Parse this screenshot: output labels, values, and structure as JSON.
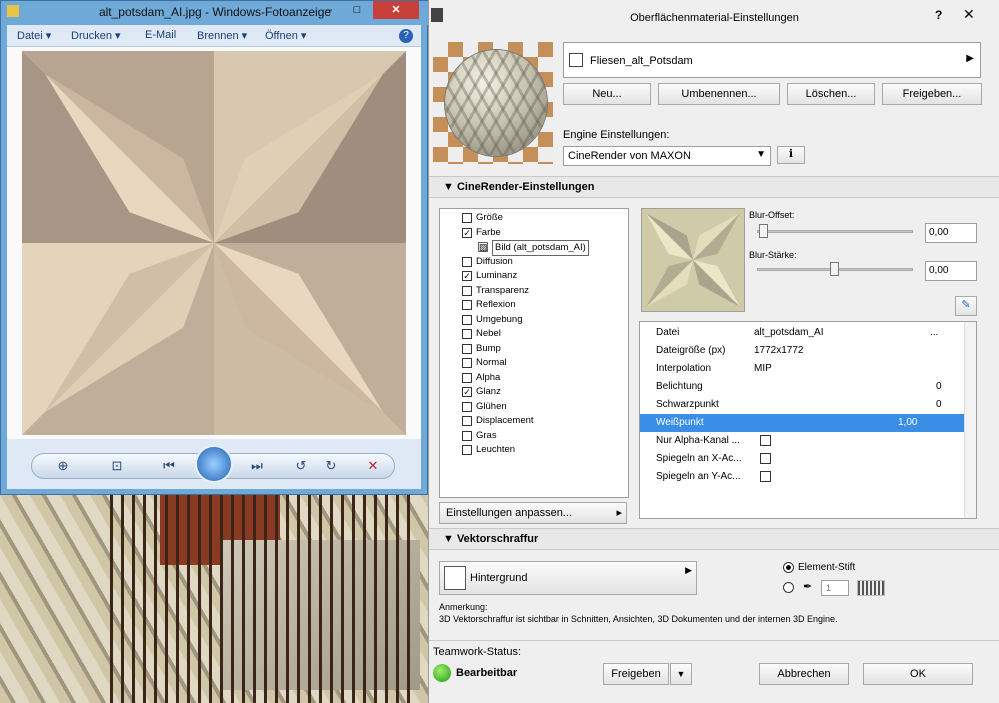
{
  "viewer": {
    "title": "alt_potsdam_AI.jpg - Windows-Fotoanzeige",
    "menu": [
      "Datei ▾",
      "Drucken ▾",
      "E-Mail",
      "Brennen ▾",
      "Öffnen ▾"
    ],
    "toolbar": [
      "zoom-icon",
      "fit-icon",
      "prev-icon",
      "slideshow-icon",
      "next-icon",
      "rotate-left-icon",
      "rotate-right-icon",
      "delete-icon"
    ]
  },
  "dialog": {
    "title": "Oberflächenmaterial-Einstellungen",
    "help": "?",
    "material_name": "Fliesen_alt_Potsdam",
    "buttons": {
      "new": "Neu...",
      "rename": "Umbenennen...",
      "delete": "Löschen...",
      "share": "Freigeben..."
    },
    "engine_label": "Engine Einstellungen:",
    "engine_value": "CineRender von MAXON",
    "section_cine": "CineRender-Einstellungen",
    "tree": [
      {
        "label": "Größe",
        "checked": false
      },
      {
        "label": "Farbe",
        "checked": true
      },
      {
        "label": "Bild (alt_potsdam_AI)",
        "checked": false,
        "child": true
      },
      {
        "label": "Diffusion",
        "checked": false
      },
      {
        "label": "Luminanz",
        "checked": true
      },
      {
        "label": "Transparenz",
        "checked": false
      },
      {
        "label": "Reflexion",
        "checked": false
      },
      {
        "label": "Umgebung",
        "checked": false
      },
      {
        "label": "Nebel",
        "checked": false
      },
      {
        "label": "Bump",
        "checked": false
      },
      {
        "label": "Normal",
        "checked": false
      },
      {
        "label": "Alpha",
        "checked": false
      },
      {
        "label": "Glanz",
        "checked": true
      },
      {
        "label": "Glühen",
        "checked": false
      },
      {
        "label": "Displacement",
        "checked": false
      },
      {
        "label": "Gras",
        "checked": false
      },
      {
        "label": "Leuchten",
        "checked": false
      }
    ],
    "blur_offset_label": "Blur-Offset:",
    "blur_offset_value": "0,00",
    "blur_strength_label": "Blur-Stärke:",
    "blur_strength_value": "0,00",
    "props": [
      {
        "k": "Datei",
        "v": "alt_potsdam_AI",
        "extra": "..."
      },
      {
        "k": "Dateigröße (px)",
        "v": "1772x1772"
      },
      {
        "k": "Interpolation",
        "v": "MIP"
      },
      {
        "k": "Belichtung",
        "v": "0"
      },
      {
        "k": "Schwarzpunkt",
        "v": "0"
      },
      {
        "k": "Weißpunkt",
        "v": "1,00"
      },
      {
        "k": "Nur Alpha-Kanal ...",
        "v": ""
      },
      {
        "k": "Spiegeln an X-Ac...",
        "v": ""
      },
      {
        "k": "Spiegeln an Y-Ac...",
        "v": ""
      }
    ],
    "adjust_button": "Einstellungen anpassen...",
    "section_vector": "Vektorschraffur",
    "background_label": "Hintergrund",
    "pen_label": "Element-Stift",
    "pen_number": "1",
    "note_title": "Anmerkung:",
    "note_text": "3D Vektorschraffur ist sichtbar in Schnitten, Ansichten, 3D Dokumenten und der internen 3D Engine.",
    "teamwork_label": "Teamwork-Status:",
    "teamwork_status": "Bearbeitbar",
    "share_button": "Freigeben",
    "cancel_button": "Abbrechen",
    "ok_button": "OK"
  }
}
